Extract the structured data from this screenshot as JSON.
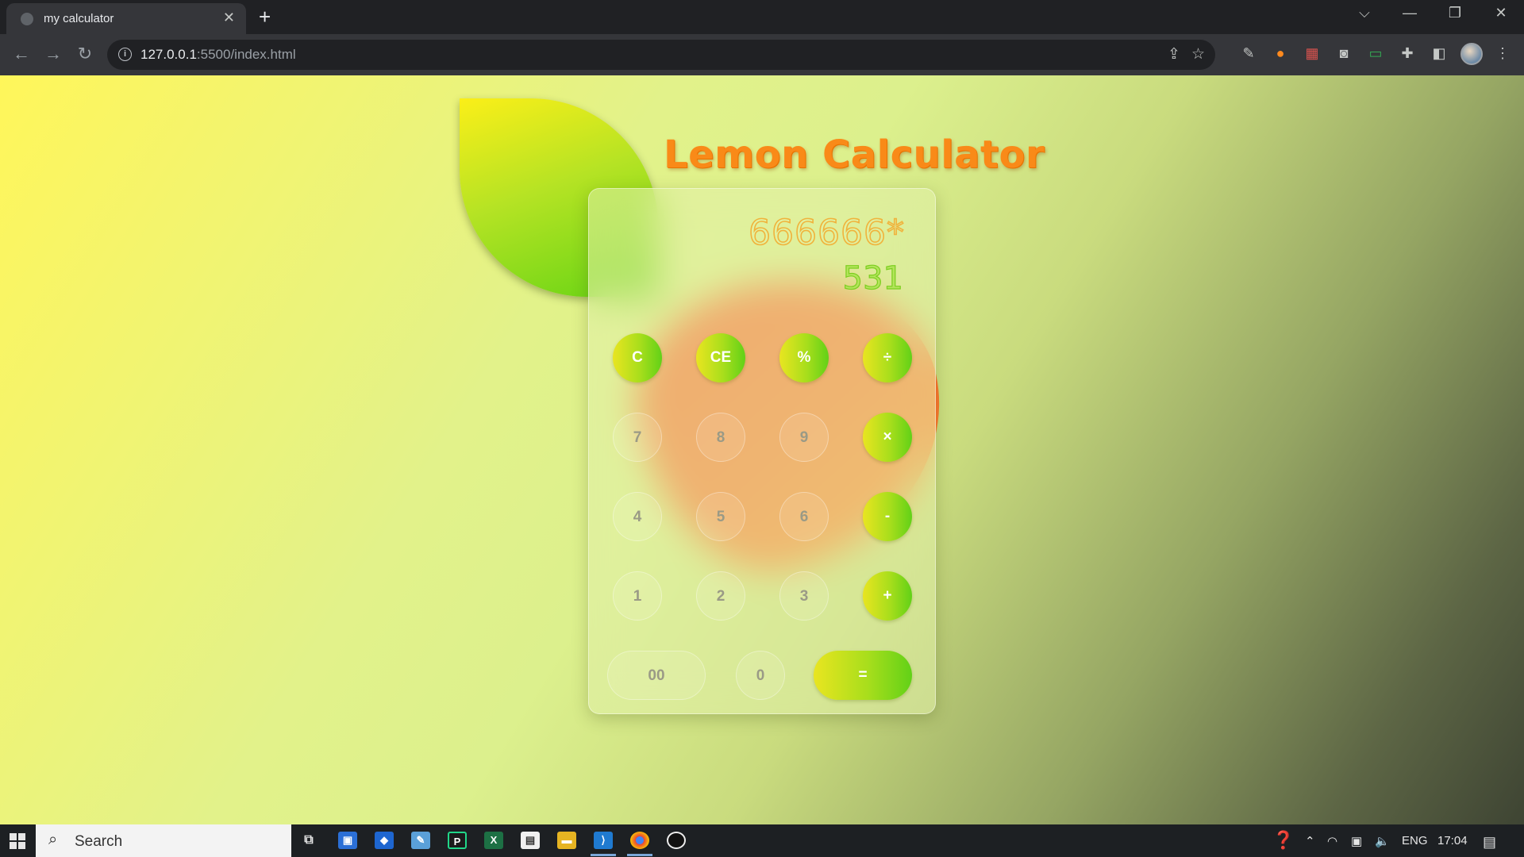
{
  "browser": {
    "tab_title": "my calculator",
    "close_glyph": "✕",
    "new_tab_glyph": "+",
    "url_host": "127.0.0.1",
    "url_path": ":5500/index.html"
  },
  "window_controls": {
    "tabsearch": "⌵",
    "minimize": "—",
    "restore": "❐",
    "close": "✕"
  },
  "nav": {
    "back": "←",
    "forward": "→",
    "reload": "↻"
  },
  "page": {
    "title": "Lemon Calculator",
    "expression": "666666*",
    "result": "531",
    "keys": [
      {
        "label": "C",
        "kind": "op"
      },
      {
        "label": "CE",
        "kind": "op"
      },
      {
        "label": "%",
        "kind": "op"
      },
      {
        "label": "÷",
        "kind": "op"
      },
      {
        "label": "7",
        "kind": "num"
      },
      {
        "label": "8",
        "kind": "num"
      },
      {
        "label": "9",
        "kind": "num"
      },
      {
        "label": "×",
        "kind": "op"
      },
      {
        "label": "4",
        "kind": "num"
      },
      {
        "label": "5",
        "kind": "num"
      },
      {
        "label": "6",
        "kind": "num"
      },
      {
        "label": "-",
        "kind": "op"
      },
      {
        "label": "1",
        "kind": "num"
      },
      {
        "label": "2",
        "kind": "num"
      },
      {
        "label": "3",
        "kind": "num"
      },
      {
        "label": "+",
        "kind": "op"
      },
      {
        "label": "00",
        "kind": "num"
      },
      {
        "label": "0",
        "kind": "num"
      },
      {
        "label": "=",
        "kind": "op"
      }
    ],
    "colors": {
      "title": "#f98a18",
      "lemon_green": "#62d117",
      "lemon_yellow": "#e9e520",
      "orange": "#ff6a2e"
    }
  },
  "taskbar": {
    "search_placeholder": "Search",
    "language": "ENG",
    "time": "17:04"
  }
}
